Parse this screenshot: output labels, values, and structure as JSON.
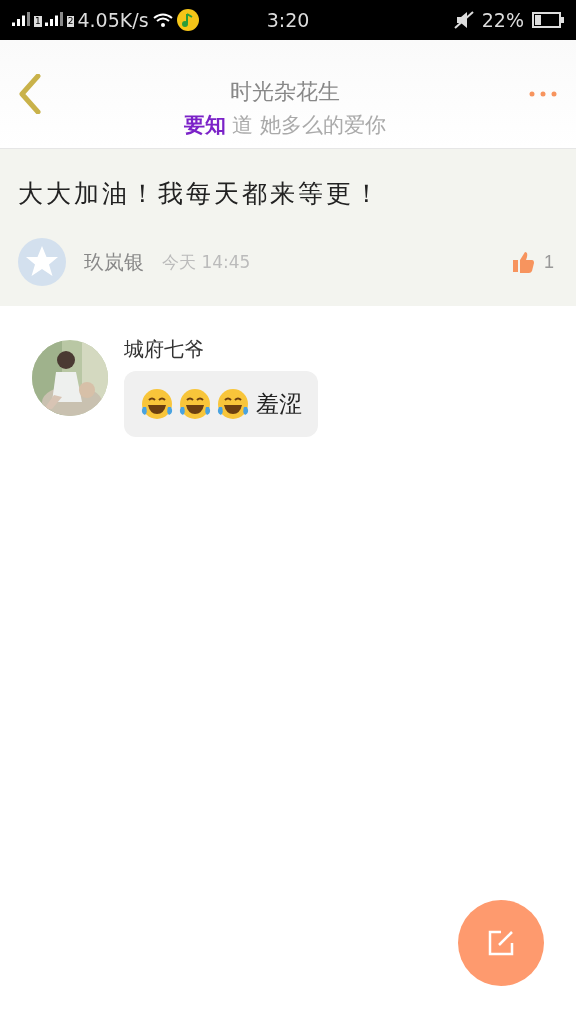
{
  "status_bar": {
    "speed": "4.05K/s",
    "time": "3:20",
    "battery": "22%",
    "sim_labels": [
      "1",
      "2"
    ]
  },
  "header": {
    "title": "时光杂花生",
    "subtitle_highlight": "要知",
    "subtitle": "道 她多么的爱你"
  },
  "post": {
    "text": "大大加油！我每天都来等更！",
    "author": "玖岚银",
    "time": "今天 14:45",
    "likes": "1"
  },
  "replies": [
    {
      "name": "城府七爷",
      "emojis": [
        {
          "kind": "laughing"
        },
        {
          "kind": "laughing"
        },
        {
          "kind": "laughing"
        }
      ],
      "text": "羞涩"
    }
  ]
}
